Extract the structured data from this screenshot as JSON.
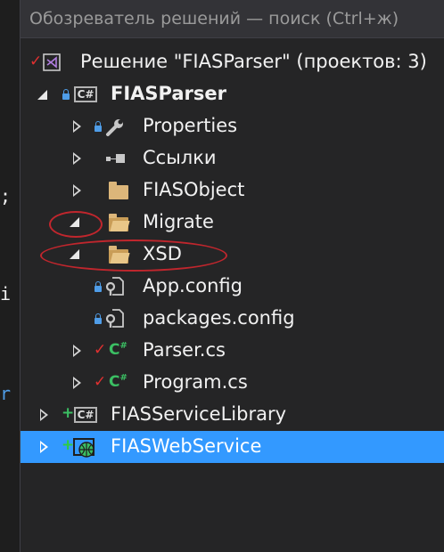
{
  "search": {
    "placeholder": "Обозреватель решений — поиск (Ctrl+ж)"
  },
  "gutter": [
    ";",
    "i",
    "r"
  ],
  "tree": {
    "solution": "Решение \"FIASParser\"  (проектов: 3)",
    "project": "FIASParser",
    "items": {
      "properties": "Properties",
      "references": "Ссылки",
      "fiasobject": "FIASObject",
      "migrate": "Migrate",
      "xsd": "XSD",
      "appconfig": "App.config",
      "packages": "packages.config",
      "parser": "Parser.cs",
      "program": "Program.cs"
    },
    "service_library": "FIASServiceLibrary",
    "web_service": "FIASWebService"
  },
  "colors": {
    "background": "#252526",
    "selection": "#3399ff",
    "annotation": "#c0262d",
    "csharp_green": "#3bbf63",
    "pending_check": "#e03030",
    "lock_blue": "#4f9de8",
    "folder": "#dcb67a"
  }
}
